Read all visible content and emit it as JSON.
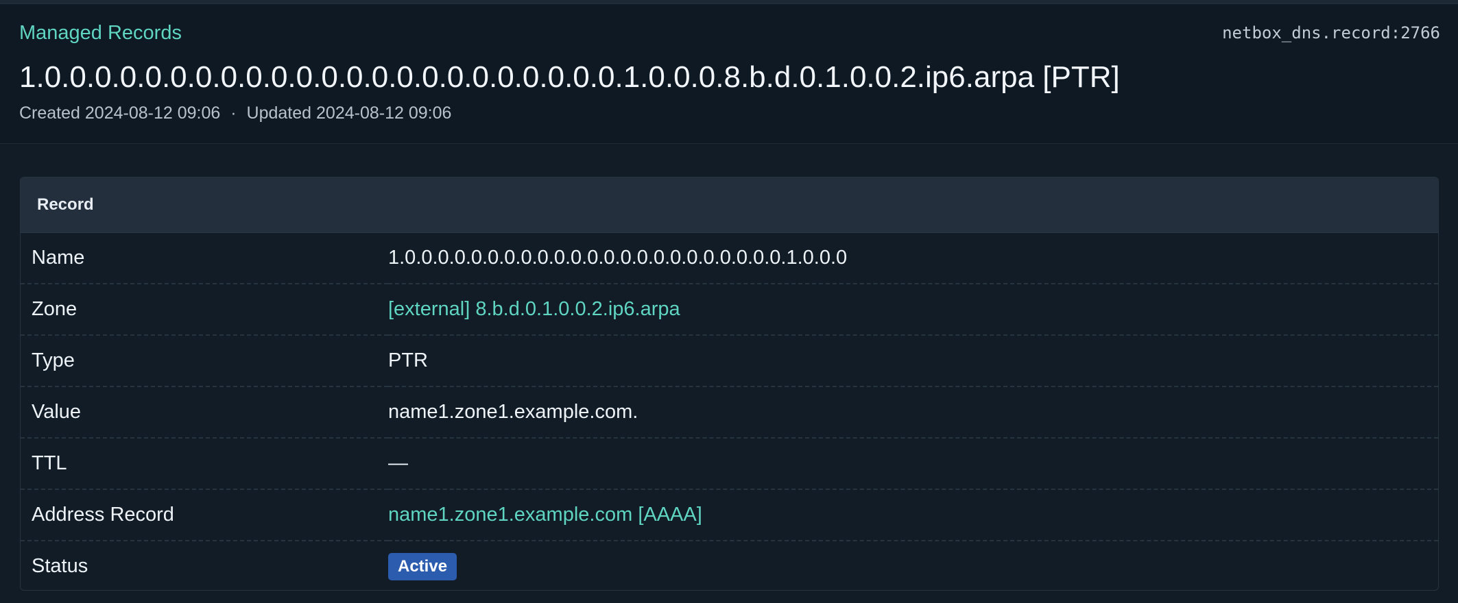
{
  "header": {
    "breadcrumb": "Managed Records",
    "object_id": "netbox_dns.record:2766",
    "title": "1.0.0.0.0.0.0.0.0.0.0.0.0.0.0.0.0.0.0.0.0.0.0.0.1.0.0.0.8.b.d.0.1.0.0.2.ip6.arpa [PTR]",
    "created_label": "Created",
    "created": "2024-08-12 09:06",
    "separator": "·",
    "updated_label": "Updated",
    "updated": "2024-08-12 09:06"
  },
  "card": {
    "title": "Record",
    "rows": {
      "name": {
        "label": "Name",
        "value": "1.0.0.0.0.0.0.0.0.0.0.0.0.0.0.0.0.0.0.0.0.0.0.0.1.0.0.0"
      },
      "zone": {
        "label": "Zone",
        "value": "[external] 8.b.d.0.1.0.0.2.ip6.arpa"
      },
      "type": {
        "label": "Type",
        "value": "PTR"
      },
      "value": {
        "label": "Value",
        "value": "name1.zone1.example.com."
      },
      "ttl": {
        "label": "TTL",
        "value": "—"
      },
      "address_record": {
        "label": "Address Record",
        "value": "name1.zone1.example.com [AAAA]"
      },
      "status": {
        "label": "Status",
        "value": "Active"
      }
    }
  },
  "colors": {
    "accent": "#5fd5c2",
    "badge_active": "#2c5cae",
    "background": "#111c26"
  }
}
